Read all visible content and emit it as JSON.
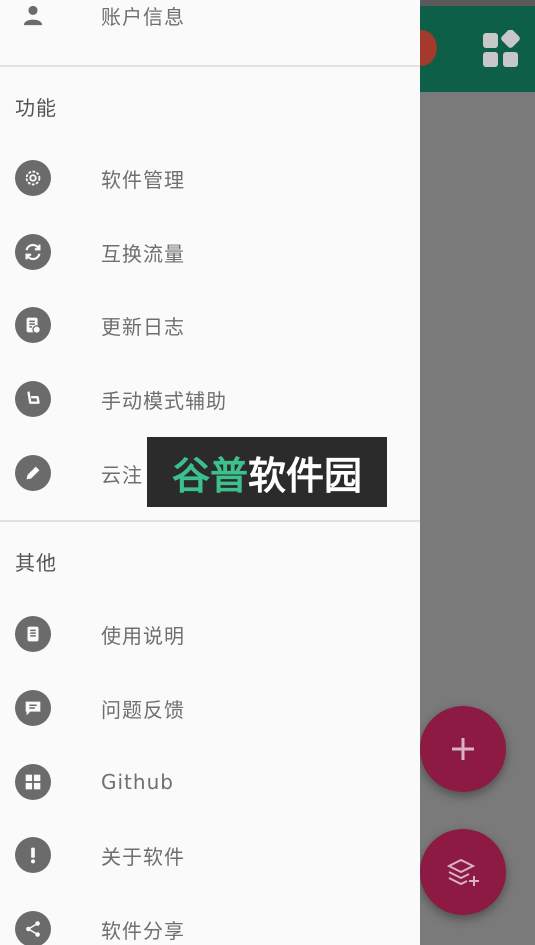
{
  "drawer": {
    "account_label": "账户信息",
    "sections": [
      {
        "header": "功能",
        "items": [
          {
            "label": "软件管理",
            "icon": "gear-icon"
          },
          {
            "label": "互换流量",
            "icon": "swap-icon"
          },
          {
            "label": "更新日志",
            "icon": "changelog-icon"
          },
          {
            "label": "手动模式辅助",
            "icon": "manual-mode-icon"
          },
          {
            "label": "云注",
            "icon": "pencil-icon"
          }
        ]
      },
      {
        "header": "其他",
        "items": [
          {
            "label": "使用说明",
            "icon": "document-icon"
          },
          {
            "label": "问题反馈",
            "icon": "feedback-icon"
          },
          {
            "label": "Github",
            "icon": "github-icon"
          },
          {
            "label": "关于软件",
            "icon": "info-icon"
          },
          {
            "label": "软件分享",
            "icon": "share-icon"
          }
        ]
      }
    ]
  },
  "watermark": {
    "part1": "谷普",
    "part2": "软件园"
  },
  "colors": {
    "toolbar": "#0d5f47",
    "fab": "#8c1a43",
    "icon_bg": "#6b6b6b",
    "watermark_green": "#3cc18e"
  }
}
